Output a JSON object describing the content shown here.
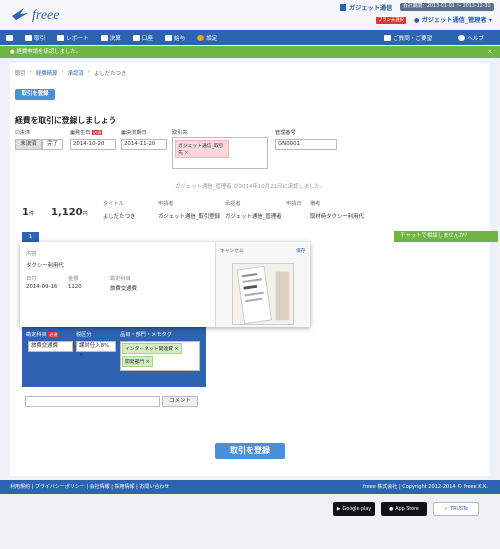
{
  "header": {
    "logo_text": "freee",
    "company": "ガジェット通信",
    "period": "会計期間：2013-01-01 〜 2013-12-31",
    "plan_badge": "プラン未選択",
    "user": "ガジェット通信_管理者"
  },
  "nav": {
    "items": [
      {
        "label": "",
        "icon": "home-icon"
      },
      {
        "label": "取引",
        "icon": "deal-icon"
      },
      {
        "label": "レポート",
        "icon": "report-icon"
      },
      {
        "label": "決算",
        "icon": "settlement-icon"
      },
      {
        "label": "口座",
        "icon": "wallet-icon"
      },
      {
        "label": "給与",
        "icon": "payroll-icon"
      },
      {
        "label": "設定",
        "icon": "settings-icon"
      }
    ],
    "feedback": "ご質問・ご要望",
    "help": "ヘルプ"
  },
  "alert": {
    "text": "経費申請を承認しました。",
    "close": "×"
  },
  "breadcrumb": [
    "取引",
    "経費精算",
    "承認済",
    "よしだたつき"
  ],
  "btn_top": "取引を登録",
  "heading": "経費を取引に登録しましょう",
  "form": {
    "settlement_label": "決済",
    "unsettled": "未決済",
    "settled": "完了",
    "issue_date_label": "発生日",
    "required": "必須",
    "issue_date": "2014-10-20",
    "due_date_label": "決済期日",
    "due_date": "2014-11-20",
    "partner_label": "取引先",
    "partner_tag": "ガジェット通信_取引先",
    "manage_no_label": "管理番号",
    "manage_no": "GN0001"
  },
  "approval_note": "ガジェット通信_管理者 が2014年10月21日に承認しました。",
  "summary": {
    "count": "1",
    "count_unit": "件",
    "amount": "1,120",
    "amount_unit": "円",
    "cols": [
      {
        "label": "タイトル",
        "value": "よしだたつき"
      },
      {
        "label": "申請者",
        "value": "ガジェット通信_取引登録"
      },
      {
        "label": "承認者",
        "value": "ガジェット通信_管理者"
      },
      {
        "label": "申請日",
        "value": ""
      },
      {
        "label": "備考",
        "value": "取材時タクシー利用代"
      }
    ]
  },
  "tab_label": "1",
  "chat": "チャットで相談しませんか？",
  "card": {
    "content_label": "内容",
    "content": "タクシー利用代",
    "date_label": "日付",
    "date": "2014-09-16",
    "amount_label": "金額",
    "amount": "1120",
    "account_label": "勘定科目",
    "account": "旅費交通費",
    "cancel": "キャンセル",
    "save": "保存"
  },
  "blue_form": {
    "account_label": "勘定科目",
    "required": "必須",
    "account": "旅費交通費",
    "tax_label": "税区分",
    "tax": "課対仕入8%",
    "item_label": "品目・部門・メモタグ",
    "tag1": "インターネット関連費",
    "tag2": "開発部門"
  },
  "comment_btn": "コメント",
  "register_btn": "取引を登録",
  "footer": {
    "links": "利用規約 | プライバシーポリシー | 会社情報 | 採用情報 | お問い合わせ",
    "copyright": "freee 株式会社 | Copyright 2012-2014 © freee K.K."
  },
  "stores": [
    "Google play",
    "App Store",
    "TRUSTe"
  ]
}
